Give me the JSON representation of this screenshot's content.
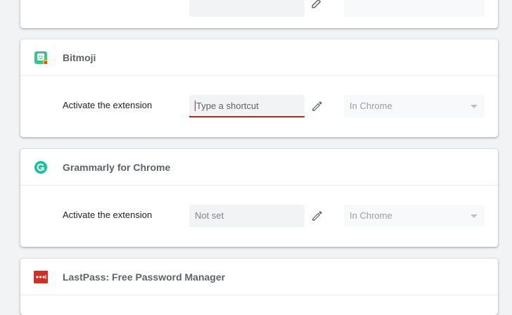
{
  "extensions": [
    {
      "name": "Bitmoji",
      "activate_label": "Activate the extension",
      "shortcut_placeholder": "Type a shortcut",
      "scope": "In Chrome",
      "icon": "bitmoji-icon"
    },
    {
      "name": "Grammarly for Chrome",
      "activate_label": "Activate the extension",
      "shortcut_value": "Not set",
      "scope": "In Chrome",
      "icon": "grammarly-icon"
    },
    {
      "name": "LastPass: Free Password Manager",
      "icon": "lastpass-icon"
    }
  ],
  "colors": {
    "accent_error": "#c5221f",
    "bitmoji": "#3ec28f",
    "grammarly": "#15c39a",
    "lastpass": "#d32d27"
  }
}
